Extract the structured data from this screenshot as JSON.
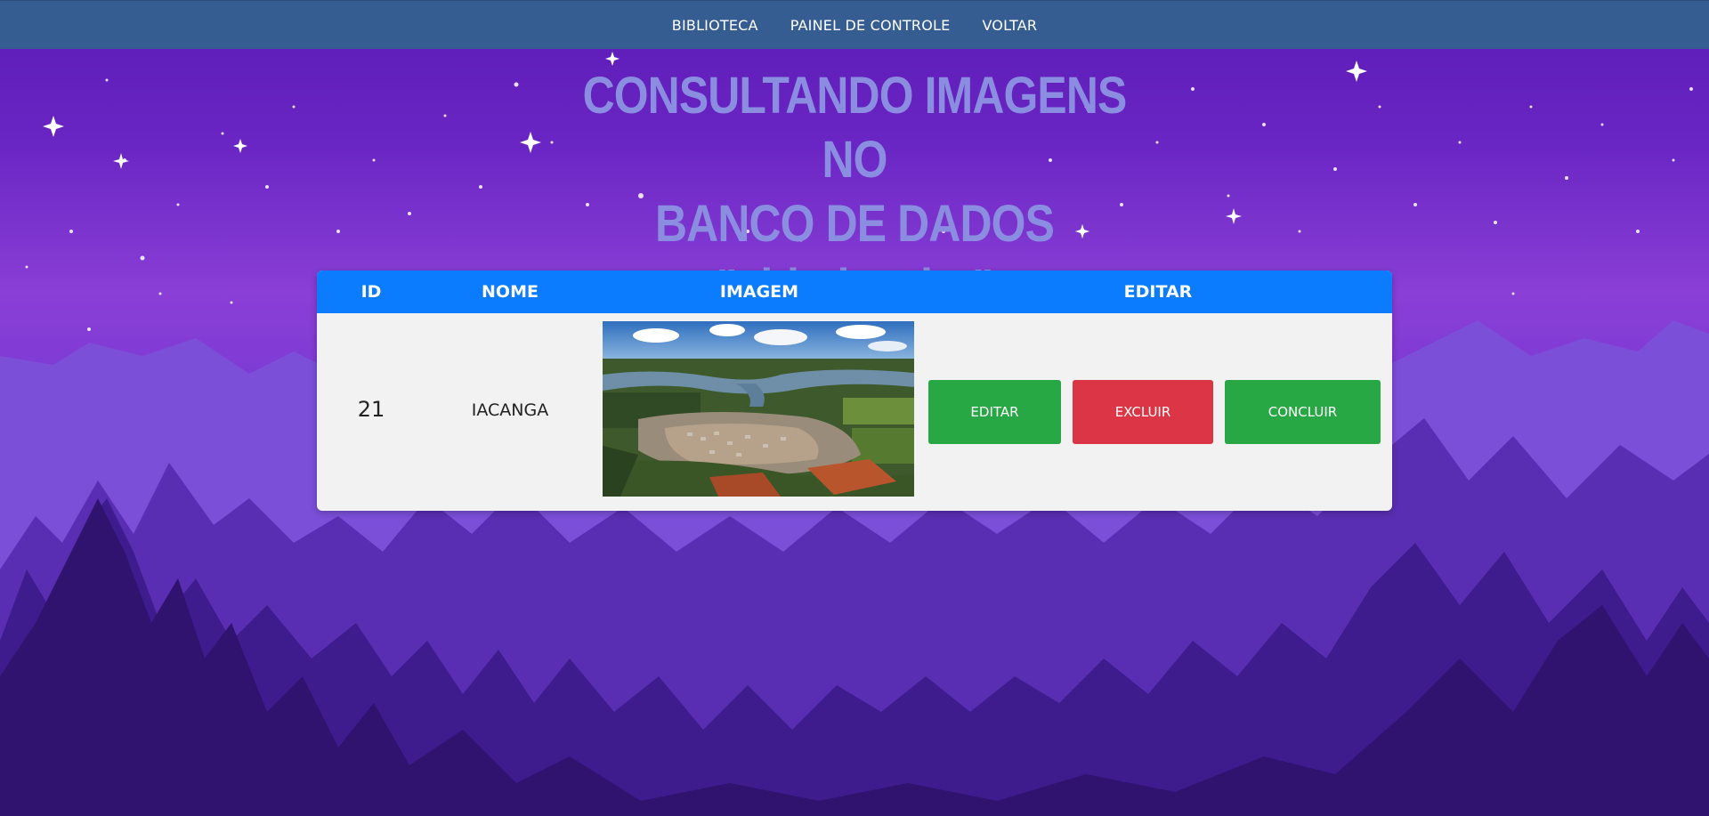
{
  "nav": {
    "items": [
      {
        "label": "BIBLIOTECA"
      },
      {
        "label": "PAINEL DE CONTROLE"
      },
      {
        "label": "VOLTAR"
      }
    ]
  },
  "page": {
    "title_lines": [
      "CONSULTANDO IMAGENS NO",
      "BANCO DE DADOS",
      "\"cidade_alto\""
    ]
  },
  "table": {
    "headers": {
      "id": "ID",
      "nome": "NOME",
      "imagem": "IMAGEM",
      "editar": "EDITAR"
    },
    "rows": [
      {
        "id": "21",
        "nome": "IACANGA",
        "actions": {
          "edit": "EDITAR",
          "delete": "EXCLUIR",
          "complete": "CONCLUIR"
        }
      }
    ]
  },
  "colors": {
    "navbar": "#355d92",
    "table_header": "#0a7cfd",
    "title": "#8b8ee0",
    "btn_green": "#28a745",
    "btn_red": "#dc3545"
  }
}
